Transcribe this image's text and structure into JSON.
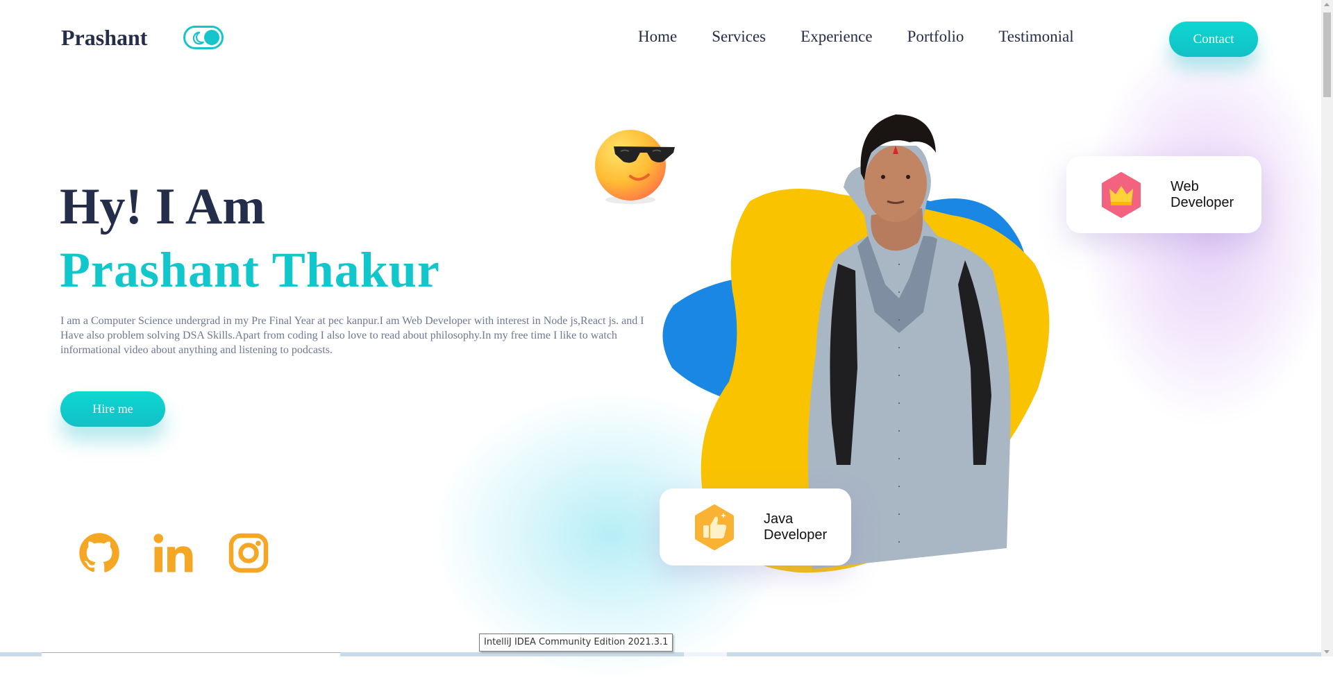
{
  "header": {
    "brand": "Prashant",
    "nav": [
      "Home",
      "Services",
      "Experience",
      "Portfolio",
      "Testimonial"
    ],
    "contact_label": "Contact"
  },
  "hero": {
    "greeting": "Hy! I Am",
    "name": "Prashant Thakur",
    "description": "I am a Computer Science undergrad in my Pre Final Year at pec kanpur.I am Web Developer with interest in Node js,React js. and I Have also problem solving DSA Skills.Apart from coding I also love to read about philosophy.In my free time I like to watch informational video about anything and listening to podcasts.",
    "hire_label": "Hire me"
  },
  "social": [
    {
      "icon": "github-icon"
    },
    {
      "icon": "linkedin-icon"
    },
    {
      "icon": "instagram-icon"
    }
  ],
  "cards": {
    "web": {
      "line1": "Web",
      "line2": "Developer",
      "icon": "crown-icon"
    },
    "java": {
      "line1": "Java",
      "line2": "Developer",
      "icon": "thumbs-up-icon"
    }
  },
  "tooltip": "IntelliJ IDEA Community Edition 2021.3.1",
  "colors": {
    "accent": "#12c7cc",
    "dark": "#242d49",
    "social": "#f5a623",
    "blob_yellow": "#f9c300",
    "blob_blue": "#1b87e5"
  }
}
